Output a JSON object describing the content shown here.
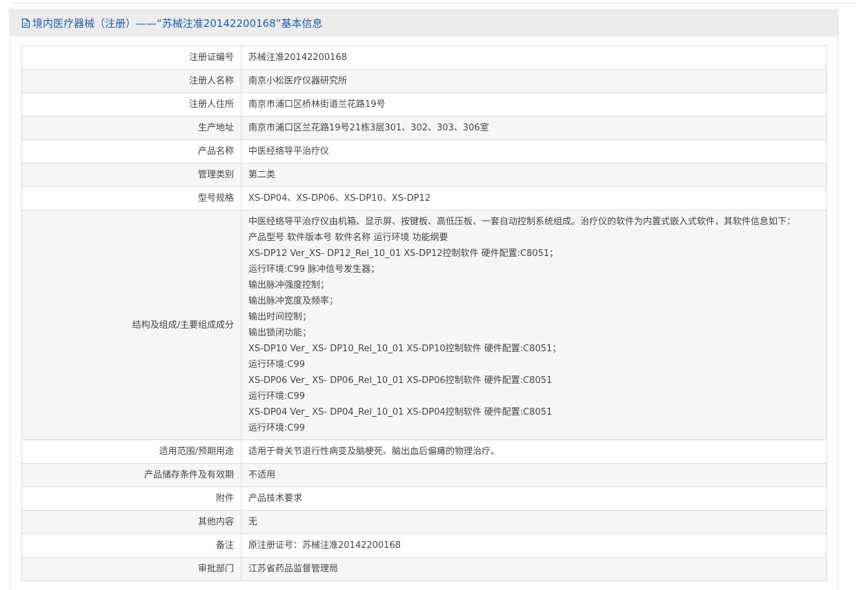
{
  "header": {
    "title": "境内医疗器械（注册）——“苏械注准20142200168”基本信息",
    "icon": "document-icon"
  },
  "rows": [
    {
      "label": "注册证编号",
      "value": "苏械注准20142200168"
    },
    {
      "label": "注册人名称",
      "value": "南京小松医疗仪器研究所"
    },
    {
      "label": "注册人住所",
      "value": "南京市浦口区桥林街道兰花路19号"
    },
    {
      "label": "生产地址",
      "value": "南京市浦口区兰花路19号21栋3层301、302、303、306室"
    },
    {
      "label": "产品名称",
      "value": "中医经络导平治疗仪"
    },
    {
      "label": "管理类别",
      "value": "第二类"
    },
    {
      "label": "型号规格",
      "value": "XS-DP04、XS-DP06、XS-DP10、XS-DP12"
    },
    {
      "label": "结构及组成/主要组成成分",
      "lines": [
        "中医经络导平治疗仪由机箱、显示屏、按键板、高低压板、一套自动控制系统组成。治疗仪的软件为内置式嵌入式软件，其软件信息如下：",
        "产品型号 软件版本号 软件名称 运行环境 功能纲要",
        "XS-DP12 Ver_XS- DP12_Rel_10_01 XS-DP12控制软件 硬件配置:C8051；",
        "运行环境:C99 脉冲信号发生器；",
        "输出脉冲强度控制；",
        "输出脉冲宽度及频率；",
        "输出时间控制；",
        "输出锁闭功能；",
        "XS-DP10 Ver_ XS- DP10_Rel_10_01 XS-DP10控制软件 硬件配置:C8051；",
        "运行环境:C99",
        "XS-DP06 Ver_ XS- DP06_Rel_10_01 XS-DP06控制软件 硬件配置:C8051",
        "运行环境:C99",
        "XS-DP04 Ver_ XS- DP04_Rel_10_01 XS-DP04控制软件 硬件配置:C8051",
        "运行环境:C99"
      ]
    },
    {
      "label": "适用范围/预期用途",
      "value": "适用于骨关节退行性病变及脑梗死、脑出血后偏瘫的物理治疗。"
    },
    {
      "label": "产品储存条件及有效期",
      "value": "不适用"
    },
    {
      "label": "附件",
      "value": "产品技术要求"
    },
    {
      "label": "其他内容",
      "value": "无"
    },
    {
      "label": "备注",
      "value": "原注册证号：苏械注准20142200168"
    },
    {
      "label": "审批部门",
      "value": "江苏省药品监督管理局"
    }
  ],
  "colors": {
    "title": "#1f5fa8",
    "header_bg": "#ececec",
    "row_alt_bg": "#f6f6f6",
    "border": "#d9d9d9"
  }
}
